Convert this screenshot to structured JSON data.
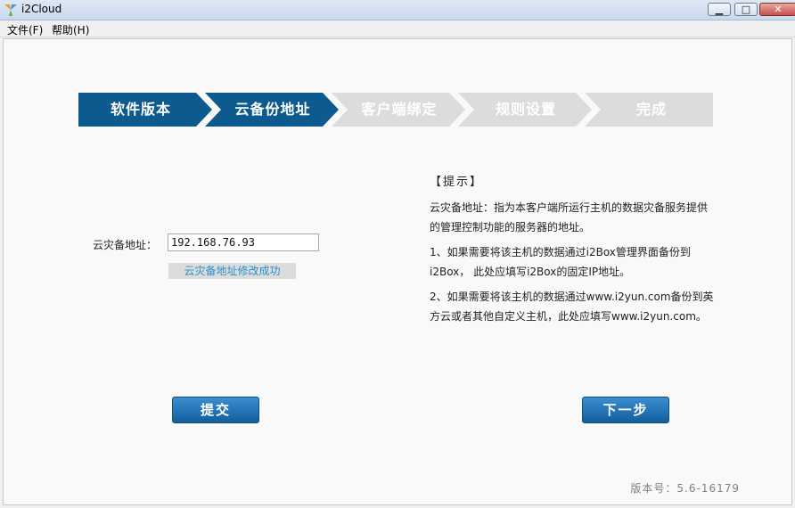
{
  "window": {
    "title": "i2Cloud"
  },
  "menu": {
    "file": "文件(F)",
    "help": "帮助(H)"
  },
  "steps": [
    {
      "label": "软件版本",
      "state": "done"
    },
    {
      "label": "云备份地址",
      "state": "active"
    },
    {
      "label": "客户端绑定",
      "state": "pending"
    },
    {
      "label": "规则设置",
      "state": "pending"
    },
    {
      "label": "完成",
      "state": "pending"
    }
  ],
  "form": {
    "label": "云灾备地址：",
    "address_value": "192.168.76.93",
    "status": "云灾备地址修改成功"
  },
  "tip": {
    "title": "【提示】",
    "paragraphs": [
      "云灾备地址：指为本客户端所运行主机的数据灾备服务提供的管理控制功能的服务器的地址。",
      "1、如果需要将该主机的数据通过i2Box管理界面备份到i2Box， 此处应填写i2Box的固定IP地址。",
      "2、如果需要将该主机的数据通过www.i2yun.com备份到英方云或者其他自定义主机，此处应填写www.i2yun.com。"
    ]
  },
  "buttons": {
    "submit": "提交",
    "next": "下一步"
  },
  "version": "版本号：5.6-16179",
  "colors": {
    "step_active": "#0d5a8e",
    "step_pending": "#dcdcdc",
    "status_text": "#2a8fc9",
    "button": "#1a6aa8"
  }
}
